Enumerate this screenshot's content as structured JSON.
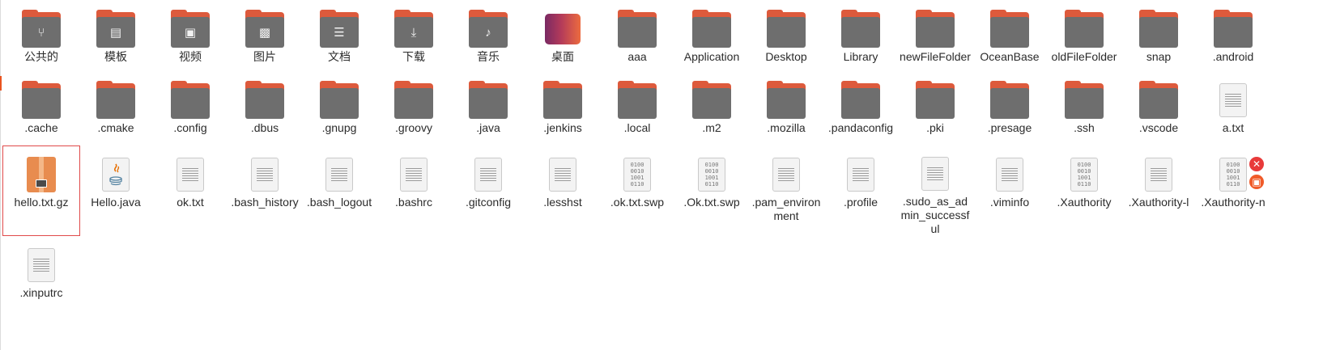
{
  "colors": {
    "folder_body": "#6e6e6e",
    "folder_tab": "#dd5a3c",
    "selection_outline": "#e04a4a",
    "emblem_red": "#e83a3a",
    "emblem_orange": "#f05a28"
  },
  "items": [
    {
      "name": "公共的",
      "kind": "folder",
      "glyph": "share-icon"
    },
    {
      "name": "模板",
      "kind": "folder",
      "glyph": "template-icon"
    },
    {
      "name": "视频",
      "kind": "folder",
      "glyph": "video-icon"
    },
    {
      "name": "图片",
      "kind": "folder",
      "glyph": "picture-icon"
    },
    {
      "name": "文档",
      "kind": "folder",
      "glyph": "document-icon"
    },
    {
      "name": "下载",
      "kind": "folder",
      "glyph": "download-icon"
    },
    {
      "name": "音乐",
      "kind": "folder",
      "glyph": "music-icon"
    },
    {
      "name": "桌面",
      "kind": "desktop"
    },
    {
      "name": "aaa",
      "kind": "folder"
    },
    {
      "name": "Application",
      "kind": "folder"
    },
    {
      "name": "Desktop",
      "kind": "folder"
    },
    {
      "name": "Library",
      "kind": "folder"
    },
    {
      "name": "newFileFolder",
      "kind": "folder"
    },
    {
      "name": "OceanBase",
      "kind": "folder"
    },
    {
      "name": "oldFileFolder",
      "kind": "folder"
    },
    {
      "name": "snap",
      "kind": "folder"
    },
    {
      "name": ".android",
      "kind": "folder"
    },
    {
      "name": ".cache",
      "kind": "folder"
    },
    {
      "name": ".cmake",
      "kind": "folder"
    },
    {
      "name": ".config",
      "kind": "folder"
    },
    {
      "name": ".dbus",
      "kind": "folder"
    },
    {
      "name": ".gnupg",
      "kind": "folder"
    },
    {
      "name": ".groovy",
      "kind": "folder"
    },
    {
      "name": ".java",
      "kind": "folder"
    },
    {
      "name": ".jenkins",
      "kind": "folder"
    },
    {
      "name": ".local",
      "kind": "folder"
    },
    {
      "name": ".m2",
      "kind": "folder"
    },
    {
      "name": ".mozilla",
      "kind": "folder"
    },
    {
      "name": ".pandaconfig",
      "kind": "folder"
    },
    {
      "name": ".pki",
      "kind": "folder"
    },
    {
      "name": ".presage",
      "kind": "folder"
    },
    {
      "name": ".ssh",
      "kind": "folder"
    },
    {
      "name": ".vscode",
      "kind": "folder"
    },
    {
      "name": "a.txt",
      "kind": "text"
    },
    {
      "name": "hello.txt.gz",
      "kind": "archive",
      "selected": true
    },
    {
      "name": "Hello.java",
      "kind": "java"
    },
    {
      "name": "ok.txt",
      "kind": "text"
    },
    {
      "name": ".bash_history",
      "kind": "text"
    },
    {
      "name": ".bash_logout",
      "kind": "text"
    },
    {
      "name": ".bashrc",
      "kind": "text"
    },
    {
      "name": ".gitconfig",
      "kind": "text"
    },
    {
      "name": ".lesshst",
      "kind": "text"
    },
    {
      "name": ".ok.txt.swp",
      "kind": "binary"
    },
    {
      "name": ".Ok.txt.swp",
      "kind": "binary"
    },
    {
      "name": ".pam_environment",
      "kind": "text"
    },
    {
      "name": ".profile",
      "kind": "text"
    },
    {
      "name": ".sudo_as_admin_successful",
      "kind": "text"
    },
    {
      "name": ".viminfo",
      "kind": "text"
    },
    {
      "name": ".Xauthority",
      "kind": "binary"
    },
    {
      "name": ".Xauthority-l",
      "kind": "text"
    },
    {
      "name": ".Xauthority-n",
      "kind": "binary",
      "emblems": [
        "unreadable-icon",
        "lock-icon"
      ]
    },
    {
      "name": ".xinputrc",
      "kind": "text"
    }
  ],
  "binary_glyph_lines": [
    "0100",
    "0010",
    "1001",
    "0110"
  ]
}
